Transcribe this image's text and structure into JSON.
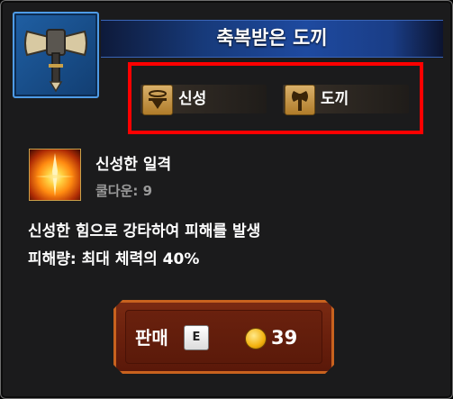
{
  "item": {
    "title": "축복받은 도끼",
    "tags": [
      {
        "label": "신성",
        "icon": "holy-icon"
      },
      {
        "label": "도끼",
        "icon": "axe-icon"
      }
    ]
  },
  "skill": {
    "name": "신성한 일격",
    "cooldown": "쿨다운: 9",
    "icon": "holy-strike-icon"
  },
  "description": [
    "신성한 힘으로 강타하여 피해를 발생",
    "피해량: 최대 체력의 40%"
  ],
  "sell": {
    "label": "판매",
    "key": "E",
    "price": "39",
    "currency_icon": "gold-coin-icon"
  },
  "colors": {
    "highlight": "#ff0000",
    "title_bar": "#1e4aa0",
    "sell_button": "#6a200d",
    "sell_border": "#c8621e"
  }
}
